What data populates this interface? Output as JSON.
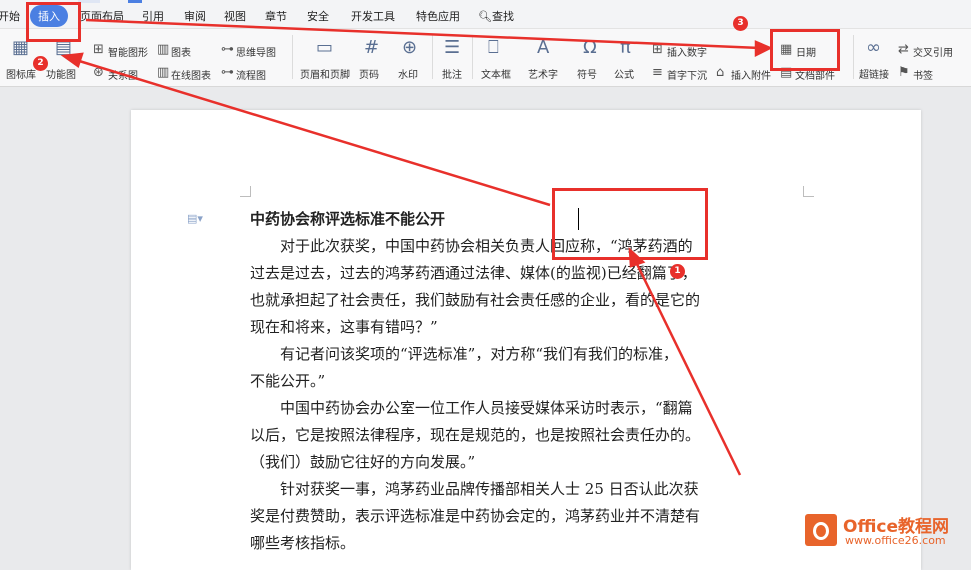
{
  "tabs": [
    "开始",
    "插入",
    "页面布局",
    "引用",
    "审阅",
    "视图",
    "章节",
    "安全",
    "开发工具",
    "特色应用"
  ],
  "search_label": "查找",
  "ribbon": {
    "icon_library": "图标库",
    "function_map": "功能图",
    "smart_shape": "智能图形",
    "chart": "图表",
    "relation": "关系图",
    "online_chart": "在线图表",
    "mind_map": "思维导图",
    "flow_chart": "流程图",
    "header_footer": "页眉和页脚",
    "page_number": "页码",
    "watermark": "水印",
    "comment": "批注",
    "textbox": "文本框",
    "art_text": "艺术字",
    "symbol": "符号",
    "formula": "公式",
    "insert_number": "插入数字",
    "drop_cap": "首字下沉",
    "attachment": "插入附件",
    "date": "日期",
    "doc_part": "文档部件",
    "hyperlink": "超链接",
    "cross_ref": "交叉引用",
    "bookmark": "书签"
  },
  "doc": {
    "title": "中药协会称评选标准不能公开",
    "lines": [
      {
        "text": "对于此次获奖，中国中药协会相关负责人回应称，“鸿茅药酒的",
        "indent": true
      },
      {
        "text": "过去是过去，过去的鸿茅药酒通过法律、媒体(的监视)已经翻篇了，",
        "indent": false
      },
      {
        "text": "也就承担起了社会责任，我们鼓励有社会责任感的企业，看的是它的",
        "indent": false
      },
      {
        "text": "现在和将来，这事有错吗？”",
        "indent": false
      },
      {
        "text": "有记者问该奖项的“评选标准”，对方称“我们有我们的标准，",
        "indent": true
      },
      {
        "text": "不能公开。”",
        "indent": false
      },
      {
        "text": "中国中药协会办公室一位工作人员接受媒体采访时表示，“翻篇",
        "indent": true
      },
      {
        "text": "以后，它是按照法律程序，现在是规范的，也是按照社会责任办的。",
        "indent": false
      },
      {
        "text": "（我们）鼓励它往好的方向发展。”",
        "indent": false
      },
      {
        "text": "针对获奖一事，鸿茅药业品牌传播部相关人士 25 日否认此次获",
        "indent": true
      },
      {
        "text": "奖是付费赞助，表示评选标准是中药协会定的，鸿茅药业并不清楚有",
        "indent": false
      },
      {
        "text": "哪些考核指标。",
        "indent": false
      }
    ]
  },
  "annotations": {
    "badge1": "1",
    "badge2": "2",
    "badge3": "3",
    "color": "#e8302b"
  },
  "watermark": {
    "line1": "Office教程网",
    "line2": "www.office26.com"
  }
}
